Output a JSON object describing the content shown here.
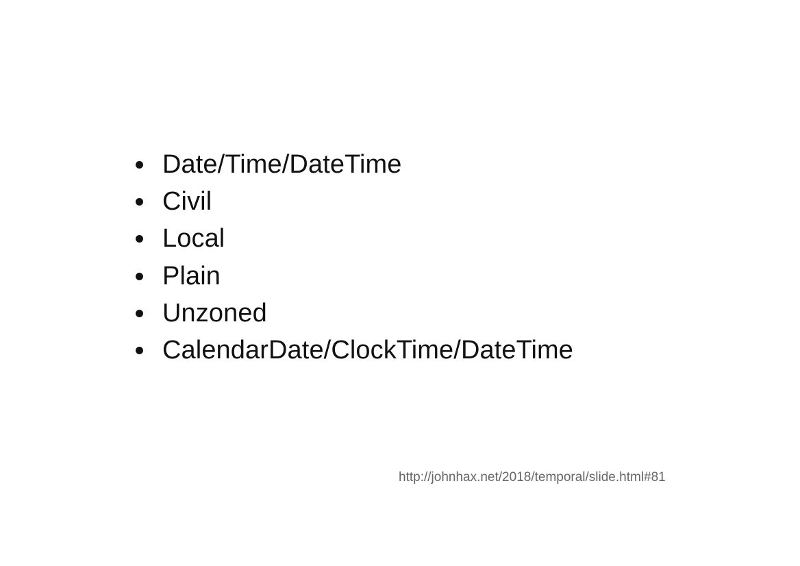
{
  "slide": {
    "bullets": [
      {
        "label": "Date/Time/DateTime"
      },
      {
        "label": "Civil"
      },
      {
        "label": "Local"
      },
      {
        "label": "Plain"
      },
      {
        "label": "Unzoned"
      },
      {
        "label": "CalendarDate/ClockTime/DateTime"
      }
    ],
    "source_url": "http://johnhax.net/2018/temporal/slide.html#81"
  },
  "colors": {
    "text": "#111111",
    "url_text": "#666666",
    "background": "#ffffff"
  }
}
